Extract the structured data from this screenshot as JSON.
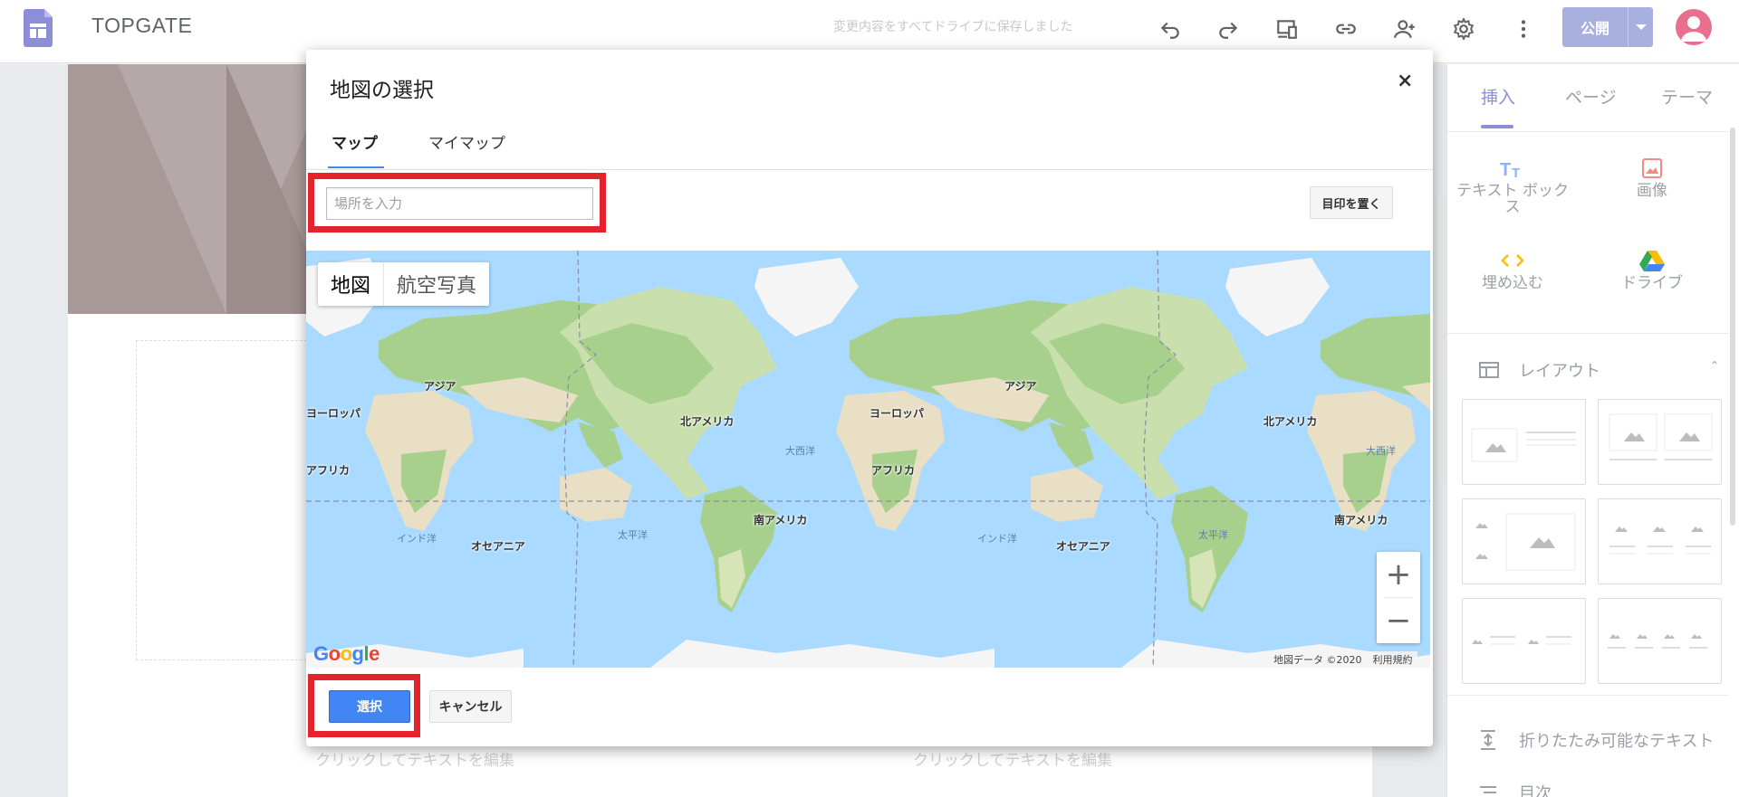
{
  "topbar": {
    "site_name": "TOPGATE",
    "save_status": "変更内容をすべてドライブに保存しました",
    "publish_label": "公開",
    "icons": [
      "undo-icon",
      "redo-icon",
      "preview-icon",
      "link-icon",
      "share-icon",
      "gear-icon",
      "more-vert-icon"
    ]
  },
  "canvas": {
    "click_hint": "クリックしてテキストを編集"
  },
  "sidebar": {
    "tabs": [
      "挿入",
      "ページ",
      "テーマ"
    ],
    "insert_items": [
      {
        "label": "テキスト ボックス",
        "icon": "text-box-icon"
      },
      {
        "label": "画像",
        "icon": "image-icon"
      },
      {
        "label": "埋め込む",
        "icon": "embed-icon"
      },
      {
        "label": "ドライブ",
        "icon": "drive-icon"
      }
    ],
    "layout_header": "レイアウト",
    "bottom_items": [
      "折りたたみ可能なテキスト",
      "目次"
    ],
    "accent": "#8a8fd8"
  },
  "dialog": {
    "title": "地図の選択",
    "close_glyph": "×",
    "tabs": [
      "マップ",
      "マイマップ"
    ],
    "search_placeholder": "場所を入力",
    "marker_button": "目印を置く",
    "map_type": {
      "map": "地図",
      "satellite": "航空写真"
    },
    "zoom_in": "+",
    "zoom_out": "−",
    "google_logo": "Google",
    "attribution": {
      "data": "地図データ ©2020",
      "terms": "利用規約"
    },
    "labels": {
      "asia": "アジア",
      "europe": "ヨーロッパ",
      "africa": "アフリカ",
      "north_america": "北アメリカ",
      "south_america": "南アメリカ",
      "oceania": "オセアニア",
      "atlantic": "大西洋",
      "pacific": "太平洋",
      "indian": "インド洋"
    },
    "select_button": "選択",
    "cancel_button": "キャンセル",
    "highlight_color": "#e4232d",
    "primary_color": "#4285f4"
  }
}
